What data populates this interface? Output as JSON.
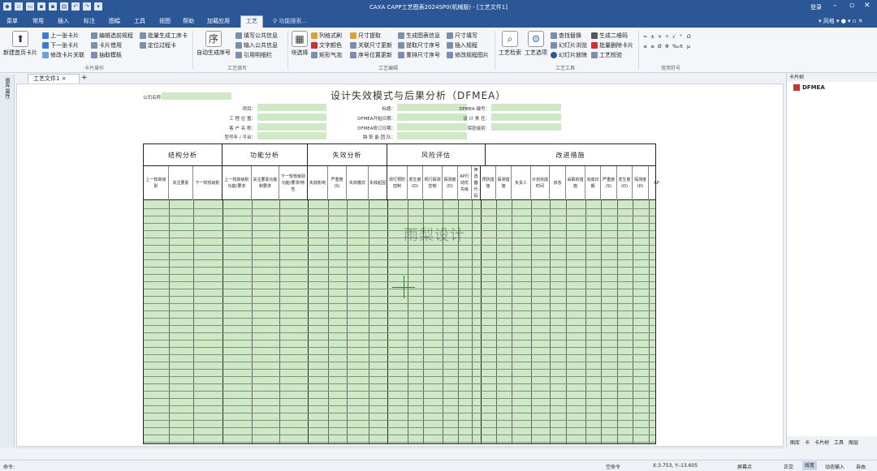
{
  "app": {
    "title": "CAXA CAPP工艺图表2024SP0(机械版) - [工艺文件1]",
    "login": "登录",
    "style": "风格",
    "search": "功能搜索..."
  },
  "menus": [
    "菜单",
    "常用",
    "插入",
    "标注",
    "图幅",
    "工具",
    "视图",
    "帮助",
    "加载应用",
    "工艺"
  ],
  "ribbon": {
    "card_ops": {
      "big": "新建首页卡片",
      "items": [
        "上一张卡片",
        "下一张卡片",
        "修改卡片关联",
        "编辑选前规程",
        "卡片借用",
        "抽取模板",
        "批量生成工序卡",
        "定位过程卡"
      ],
      "group": "卡片操作"
    },
    "process_fill": {
      "big": "自动生成序号",
      "items": [
        "填写公共信息",
        "输入公共信息",
        "引用明细栏"
      ],
      "group": "工艺填写"
    },
    "process_edit": {
      "big": "块选择",
      "items": [
        "列格式刷",
        "文字颜色",
        "矩形气泡",
        "尺寸提取",
        "关联尺寸更新",
        "序号位置更新",
        "生成图表信息",
        "提取尺寸序号",
        "重排尺寸序号",
        "尺寸填写",
        "插入规程",
        "修改规程图片"
      ],
      "group": "工艺编辑"
    },
    "process_tools": {
      "big1": "工艺检索",
      "big2": "工艺选项",
      "items": [
        "查找替换",
        "幻灯片浏览",
        "幻灯片放映",
        "生成二维码",
        "批量删除卡片",
        "工艺校验"
      ],
      "group": "工艺工具"
    },
    "symbols": {
      "items": [
        "≈",
        "±",
        "×",
        "÷",
        "√",
        "°",
        "Ω",
        "≤",
        "≥",
        "Ø",
        "Φ",
        "‰",
        "π",
        "μ"
      ],
      "group": "常用符号"
    }
  },
  "doc_tab": "工艺文件1",
  "left_tab": "图库 属性",
  "right_panel": {
    "title": "卡片树",
    "node": "DFMEA",
    "bottom": [
      "图库",
      "卡",
      "卡片树",
      "工具",
      "图层"
    ]
  },
  "form": {
    "title": "设计失效模式与后果分析（DFMEA）",
    "header": {
      "l0": "公司名称",
      "col1": [
        "项目：",
        "工 程 位 置：",
        "客 户 名 称：",
        "型号年 / 平台："
      ],
      "col2": [
        "标题：",
        "DFMEA开始日期：",
        "DFMEA修订日期：",
        "跨 职 能 团 队："
      ],
      "col3": [
        "DFMEA 编号：",
        "设 计 责 任：",
        "保密级别："
      ]
    },
    "sections": [
      "结构分析",
      "功能分析",
      "失效分析",
      "风险评估",
      "改进措施"
    ],
    "sub_columns": [
      "上一较高级别",
      "关注要素",
      "下一较低级别",
      "上一较高级别功能/要求",
      "关注要素功能和要求",
      "下一较低级别功能/要求/特性",
      "失效影响",
      "严重度(S)",
      "失效模式",
      "失效起因",
      "现行预防控制",
      "发生度(O)",
      "现行探测控制",
      "探测度(D)",
      "AP行动优先级",
      "筛选器代码",
      "预防措施",
      "探测措施",
      "负责人",
      "计划完成时间",
      "状态",
      "采取的措施",
      "完成日期",
      "严重度(S)",
      "发生度(O)",
      "探测度(D)",
      "AP"
    ],
    "watermark": "雨梨设计"
  },
  "status": {
    "cmd": "命令:",
    "mid": "空命令",
    "coord": "X:3.753, Y:-13.605",
    "items": [
      "屏幕点",
      "正交",
      "线宽",
      "动态输入",
      "自由"
    ]
  },
  "colors": {
    "accent": "#2b5797",
    "fill": "#cdeac4"
  }
}
